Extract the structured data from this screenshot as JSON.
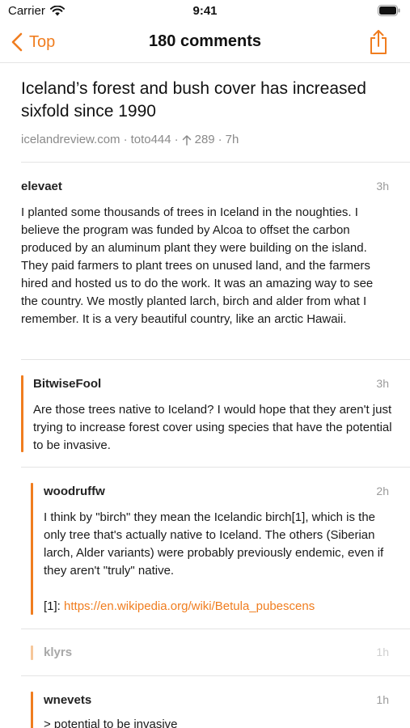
{
  "status_bar": {
    "carrier": "Carrier",
    "time": "9:41"
  },
  "nav": {
    "back_label": "Top",
    "title": "180 comments"
  },
  "story": {
    "title": "Iceland’s forest and bush cover has increased sixfold since 1990",
    "domain": "icelandreview.com",
    "sep": "·",
    "author": "toto444",
    "points": "289",
    "age": "7h"
  },
  "comments": [
    {
      "author": "elevaet",
      "age": "3h",
      "text": "I planted some thousands of trees in Iceland in the noughties. I believe the program was funded by Alcoa to offset the carbon produced by an aluminum plant they were building on the island. They paid farmers to plant trees on unused land, and the farmers hired and hosted us to do the work. It was an amazing way to see the country. We mostly planted larch, birch and alder from what I remember. It is a very beautiful country, like an arctic Hawaii."
    },
    {
      "author": "BitwiseFool",
      "age": "3h",
      "text": "Are those trees native to Iceland? I would hope that they aren't just trying to increase forest cover using species that have the potential to be invasive."
    },
    {
      "author": "woodruffw",
      "age": "2h",
      "text": "I think by \"birch\" they mean the Icelandic birch[1], which is the only tree that's actually native to Iceland. The others (Siberian larch, Alder variants) were probably previously endemic, even if they aren't \"truly\" native.",
      "ref_label": "[1]:",
      "ref_link": "https://en.wikipedia.org/wiki/Betula_pubescens"
    },
    {
      "author": "klyrs",
      "age": "1h"
    },
    {
      "author": "wnevets",
      "age": "1h",
      "text": "> potential to be invasive"
    }
  ],
  "icons": [
    "wifi-icon",
    "battery-icon",
    "chevron-left-icon",
    "share-icon",
    "arrow-up-icon"
  ],
  "colors": {
    "accent": "#f07d1f",
    "accent_faded": "#f6c79a",
    "meta": "#8a8a8a"
  }
}
